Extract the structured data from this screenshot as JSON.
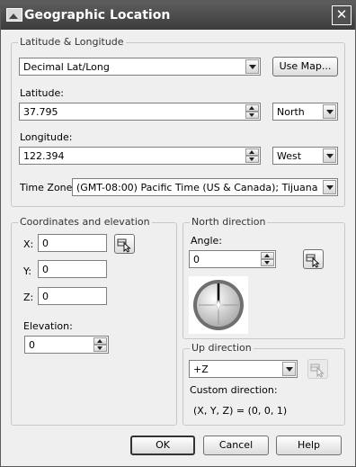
{
  "window": {
    "title": "Geographic Location",
    "close_glyph": "✕"
  },
  "latlong": {
    "group_label": "Latitude & Longitude",
    "format": "Decimal Lat/Long",
    "use_map_label": "Use Map...",
    "latitude_label": "Latitude:",
    "latitude_value": "37.795",
    "latitude_dir": "North",
    "longitude_label": "Longitude:",
    "longitude_value": "122.394",
    "longitude_dir": "West",
    "timezone_label": "Time Zone:",
    "timezone_value": "(GMT-08:00) Pacific Time (US & Canada); Tijuana"
  },
  "coords": {
    "group_label": "Coordinates and elevation",
    "x_label": "X:",
    "x_value": "0",
    "y_label": "Y:",
    "y_value": "0",
    "z_label": "Z:",
    "z_value": "0",
    "elevation_label": "Elevation:",
    "elevation_value": "0"
  },
  "north": {
    "group_label": "North direction",
    "angle_label": "Angle:",
    "angle_value": "0"
  },
  "up": {
    "group_label": "Up direction",
    "value": "+Z",
    "custom_label": "Custom direction:",
    "custom_value": "(X, Y, Z) = (0, 0, 1)"
  },
  "buttons": {
    "ok": "OK",
    "cancel": "Cancel",
    "help": "Help"
  },
  "icons": {
    "app": "geographic-location-icon",
    "pick": "pick-point-icon",
    "compass": "compass-icon",
    "close": "close-icon"
  }
}
